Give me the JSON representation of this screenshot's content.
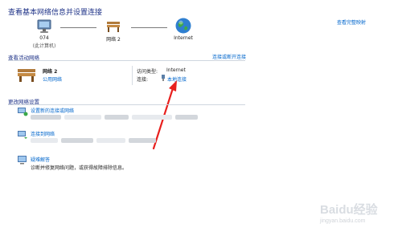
{
  "header": {
    "title": "查看基本网络信息并设置连接",
    "view_full_map": "查看完整映射"
  },
  "network_map": {
    "computer_name": "074",
    "computer_sub": "(此计算机)",
    "network_name": "网络  2",
    "internet_label": "Internet"
  },
  "active_networks": {
    "header": "查看活动网络",
    "connect_disconnect": "连接或断开连接",
    "network_name": "网络  2",
    "network_type": "公用网络",
    "access_type_label": "访问类型:",
    "access_type_value": "Internet",
    "connections_label": "连接:",
    "connections_value": "本地连接"
  },
  "change_settings": {
    "header": "更改网络设置",
    "items": [
      {
        "link": "设置新的连接或网络",
        "desc": ""
      },
      {
        "link": "连接到网络",
        "desc": ""
      },
      {
        "link": "疑难解答",
        "desc": "诊断并修复网络问题，或获得故障排除信息。"
      }
    ]
  },
  "watermark": "Baidu经验",
  "watermark_url": "jingyan.baidu.com"
}
